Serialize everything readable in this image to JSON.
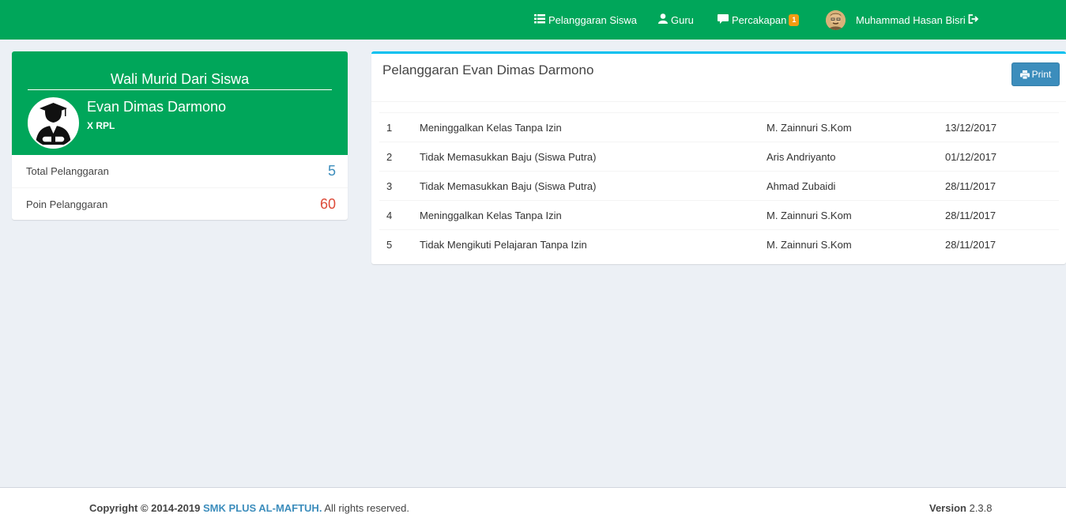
{
  "colors": {
    "navbar": "#00a65a",
    "card_header": "#00a65a",
    "box_accent": "#00c0ef",
    "primary_button": "#3c8dbc",
    "badge": "#f39c12",
    "stat_total": "#3c8dbc",
    "stat_points": "#dd4b39",
    "background": "#ecf0f5"
  },
  "navbar": {
    "items": [
      {
        "label": "Pelanggaran Siswa",
        "icon": "list-icon"
      },
      {
        "label": "Guru",
        "icon": "user-icon"
      },
      {
        "label": "Percakapan",
        "icon": "chat-icon",
        "badge": "1"
      }
    ],
    "user_name": "Muhammad Hasan Bisri",
    "user_icon": "logout-icon"
  },
  "student_card": {
    "title": "Wali Murid Dari Siswa",
    "name": "Evan Dimas Darmono",
    "class": "X RPL",
    "avatar_icon": "graduate-icon",
    "stats": [
      {
        "label": "Total Pelanggaran",
        "value": "5"
      },
      {
        "label": "Poin Pelanggaran",
        "value": "60"
      }
    ]
  },
  "violations": {
    "title": "Pelanggaran Evan Dimas Darmono",
    "print_label": "Print",
    "rows": [
      {
        "no": "1",
        "name": "Meninggalkan Kelas Tanpa Izin",
        "teacher": "M. Zainnuri S.Kom",
        "date": "13/12/2017"
      },
      {
        "no": "2",
        "name": "Tidak Memasukkan Baju (Siswa Putra)",
        "teacher": "Aris Andriyanto",
        "date": "01/12/2017"
      },
      {
        "no": "3",
        "name": "Tidak Memasukkan Baju (Siswa Putra)",
        "teacher": "Ahmad Zubaidi",
        "date": "28/11/2017"
      },
      {
        "no": "4",
        "name": "Meninggalkan Kelas Tanpa Izin",
        "teacher": "M. Zainnuri S.Kom",
        "date": "28/11/2017"
      },
      {
        "no": "5",
        "name": "Tidak Mengikuti Pelajaran Tanpa Izin",
        "teacher": "M. Zainnuri S.Kom",
        "date": "28/11/2017"
      }
    ]
  },
  "footer": {
    "copyright_prefix": "Copyright © 2014-2019",
    "org": "SMK PLUS AL-MAFTUH.",
    "suffix": "All rights reserved.",
    "version_label": "Version",
    "version": "2.3.8"
  }
}
